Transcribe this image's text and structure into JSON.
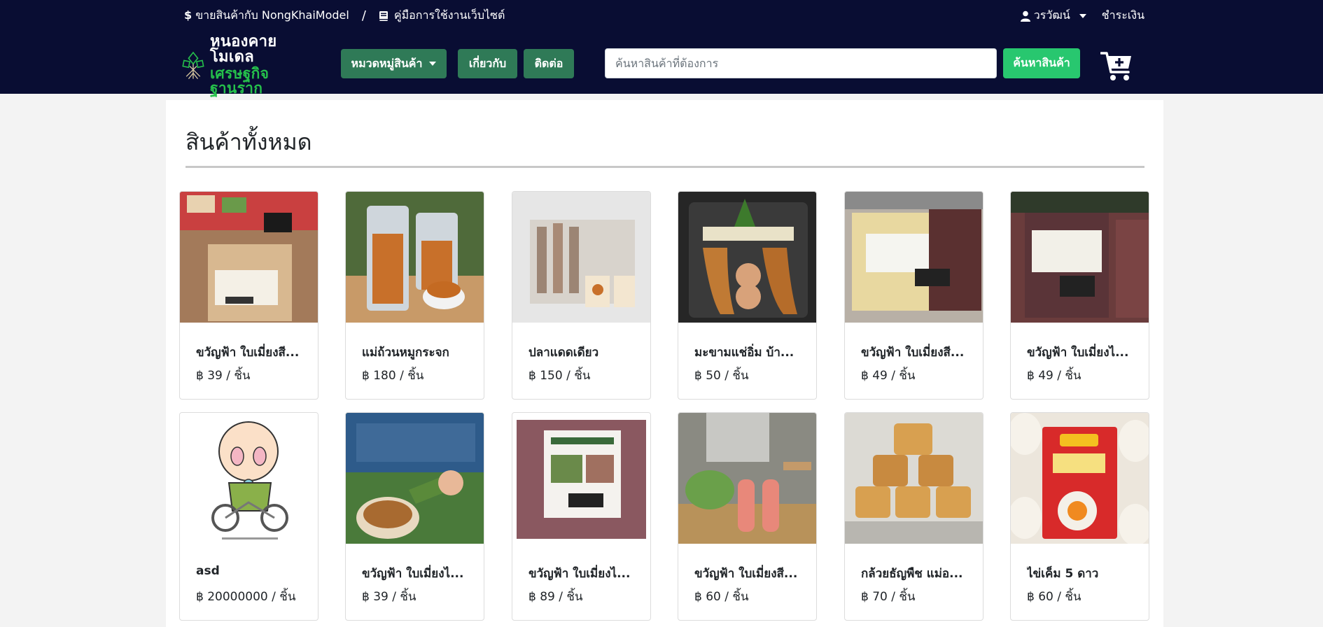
{
  "topbar": {
    "sell_link": "ขายสินค้ากับ NongKhaiModel",
    "separator": "/",
    "manual_link": "คู่มือการใช้งานเว็บไซต์",
    "user_name": "วรวัฒน์",
    "payment_link": "ชำระเงิน"
  },
  "logo": {
    "line1": "หนองคาย โมเดล",
    "line2": "เศรษฐกิจฐานราก"
  },
  "nav": {
    "category_label": "หมวดหมู่สินค้า",
    "about_label": "เกี่ยวกับ",
    "contact_label": "ติดต่อ"
  },
  "search": {
    "placeholder": "ค้นหาสินค้าที่ต้องการ",
    "button_label": "ค้นหาสินค้า"
  },
  "page": {
    "title": "สินค้าทั้งหมด"
  },
  "products": [
    {
      "name": "ขวัญฟ้า ใบเมี่ยงสี...",
      "price": "฿ 39 / ชิ้น"
    },
    {
      "name": "แม่ถ้วนหมูกระจก",
      "price": "฿ 180 / ชิ้น"
    },
    {
      "name": "ปลาแดดเดียว",
      "price": "฿ 150 / ชิ้น"
    },
    {
      "name": "มะขามแช่อิ่ม บ้า...",
      "price": "฿ 50 / ชิ้น"
    },
    {
      "name": "ขวัญฟ้า ใบเมี่ยงสี...",
      "price": "฿ 49 / ชิ้น"
    },
    {
      "name": "ขวัญฟ้า ใบเมี่ยงไ...",
      "price": "฿ 49 / ชิ้น"
    },
    {
      "name": "asd",
      "price": "฿ 20000000 / ชิ้น"
    },
    {
      "name": "ขวัญฟ้า ใบเมี่ยงไ...",
      "price": "฿ 39 / ชิ้น"
    },
    {
      "name": "ขวัญฟ้า ใบเมี่ยงไ...",
      "price": "฿ 89 / ชิ้น"
    },
    {
      "name": "ขวัญฟ้า ใบเมี่ยงสี...",
      "price": "฿ 60 / ชิ้น"
    },
    {
      "name": "กล้วยธัญพืช แม่อ...",
      "price": "฿ 70 / ชิ้น"
    },
    {
      "name": "ไข่เค็ม 5 ดาว",
      "price": "฿ 60 / ชิ้น"
    }
  ],
  "colors": {
    "header_bg": "#090d33",
    "nav_button": "#2f7a57",
    "search_button": "#28c76f",
    "logo_green": "#25c04b"
  }
}
